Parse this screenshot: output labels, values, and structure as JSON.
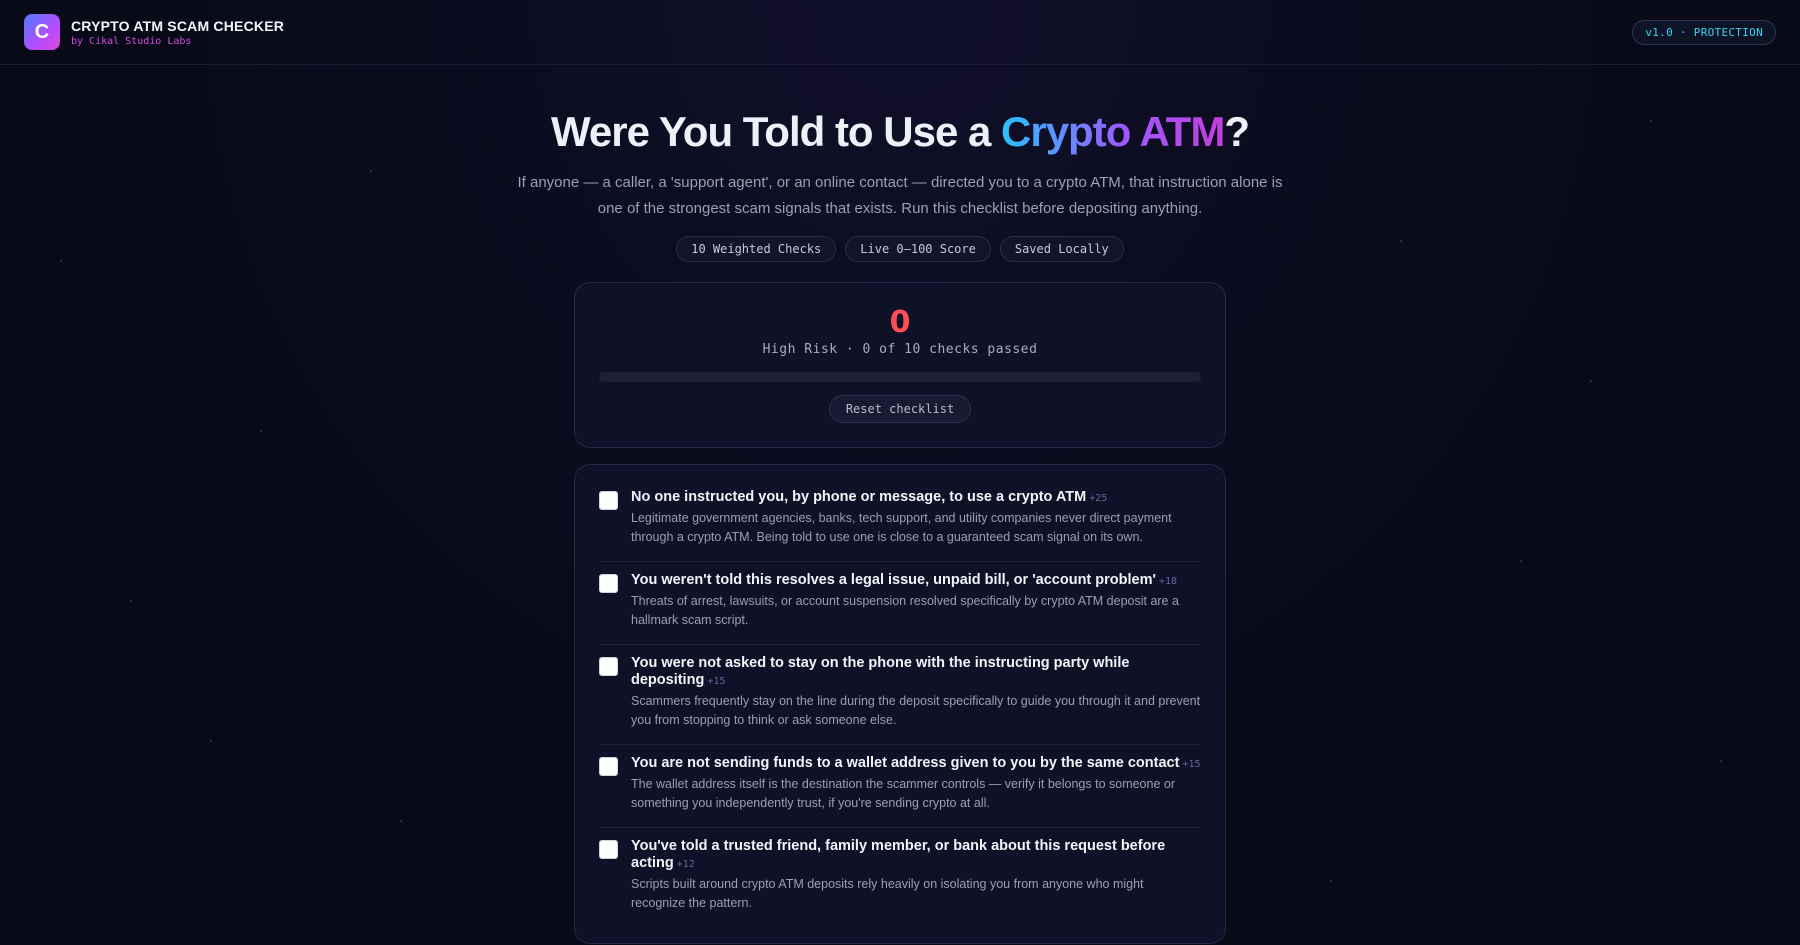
{
  "header": {
    "logo_letter": "C",
    "title": "CRYPTO ATM SCAM CHECKER",
    "subtitle": "by Cikal Studio Labs",
    "version": "v1.0 · PROTECTION"
  },
  "hero": {
    "title_pre": "Were You Told to Use a ",
    "title_highlight": "Crypto ATM",
    "title_post": "?",
    "description": "If anyone — a caller, a 'support agent', or an online contact — directed you to a crypto ATM, that instruction alone is one of the strongest scam signals that exists. Run this checklist before depositing anything.",
    "pills": [
      "10 Weighted Checks",
      "Live 0–100 Score",
      "Saved Locally"
    ]
  },
  "score": {
    "value": "0",
    "label": "High Risk · 0 of 10 checks passed",
    "progress": 0,
    "reset_label": "Reset checklist",
    "color": "#ff4d57"
  },
  "checklist": [
    {
      "title": "No one instructed you, by phone or message, to use a crypto ATM",
      "points": "+25",
      "description": "Legitimate government agencies, banks, tech support, and utility companies never direct payment through a crypto ATM. Being told to use one is close to a guaranteed scam signal on its own."
    },
    {
      "title": "You weren't told this resolves a legal issue, unpaid bill, or 'account problem'",
      "points": "+18",
      "description": "Threats of arrest, lawsuits, or account suspension resolved specifically by crypto ATM deposit are a hallmark scam script."
    },
    {
      "title": "You were not asked to stay on the phone with the instructing party while depositing",
      "points": "+15",
      "description": "Scammers frequently stay on the line during the deposit specifically to guide you through it and prevent you from stopping to think or ask someone else."
    },
    {
      "title": "You are not sending funds to a wallet address given to you by the same contact",
      "points": "+15",
      "description": "The wallet address itself is the destination the scammer controls — verify it belongs to someone or something you independently trust, if you're sending crypto at all."
    },
    {
      "title": "You've told a trusted friend, family member, or bank about this request before acting",
      "points": "+12",
      "description": "Scripts built around crypto ATM deposits rely heavily on isolating you from anyone who might recognize the pattern."
    }
  ]
}
